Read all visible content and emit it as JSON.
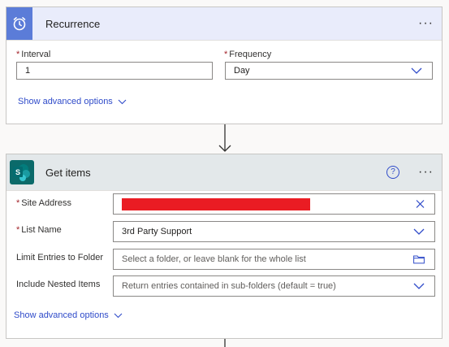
{
  "recurrence": {
    "title": "Recurrence",
    "more_label": "···",
    "interval": {
      "label": "Interval",
      "value": "1"
    },
    "frequency": {
      "label": "Frequency",
      "value": "Day"
    },
    "advanced_label": "Show advanced options"
  },
  "get_items": {
    "title": "Get items",
    "help_label": "?",
    "more_label": "···",
    "site_address": {
      "label": "Site Address"
    },
    "list_name": {
      "label": "List Name",
      "value": "3rd Party Support"
    },
    "limit_folder": {
      "label": "Limit Entries to Folder",
      "placeholder": "Select a folder, or leave blank for the whole list"
    },
    "nested_items": {
      "label": "Include Nested Items",
      "placeholder": "Return entries contained in sub-folders (default = true)"
    },
    "advanced_label": "Show advanced options"
  },
  "colors": {
    "recurrence_accent": "#5b7cd8",
    "sharepoint_accent": "#0b6a6a",
    "link": "#2f4bc9",
    "required": "#a4262c",
    "redaction": "#ea1c23"
  }
}
